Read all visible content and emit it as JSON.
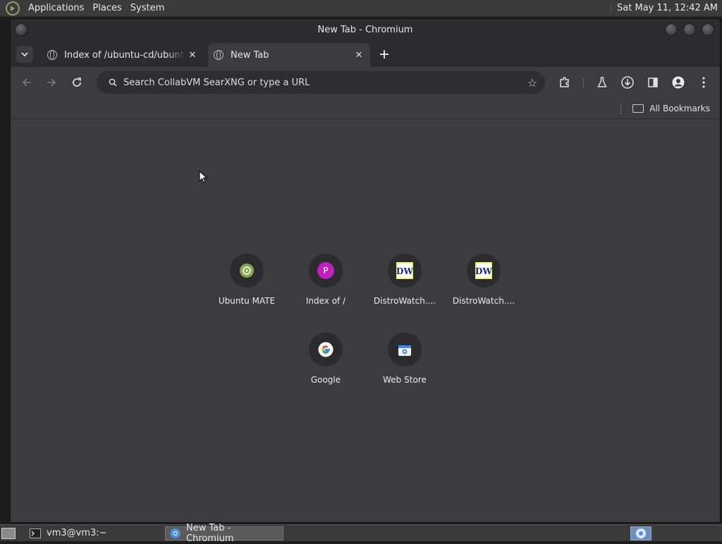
{
  "desktop": {
    "top_menu": [
      "Applications",
      "Places",
      "System"
    ],
    "clock": "Sat May 11, 12:42 AM"
  },
  "window": {
    "title": "New Tab - Chromium"
  },
  "tabs": [
    {
      "title": "Index of /ubuntu-cd/ubuntu-m",
      "close": "✕"
    },
    {
      "title": "New Tab",
      "close": "✕"
    }
  ],
  "toolbar": {
    "omnibox_placeholder": "Search CollabVM SearXNG or type a URL"
  },
  "bookmarks_bar": {
    "all_bookmarks": "All Bookmarks"
  },
  "shortcuts": [
    {
      "label": "Ubuntu MATE",
      "icon": "ubuntu-mate-icon"
    },
    {
      "label": "Index of /",
      "icon": "letter-p-icon",
      "letter": "P",
      "color": "#c020c0"
    },
    {
      "label": "DistroWatch....",
      "icon": "distrowatch-icon"
    },
    {
      "label": "DistroWatch....",
      "icon": "distrowatch-icon"
    },
    {
      "label": "Google",
      "icon": "google-icon"
    },
    {
      "label": "Web Store",
      "icon": "web-store-icon"
    }
  ],
  "taskbar": {
    "tasks": [
      "vm3@vm3:~",
      "New Tab - Chromium"
    ]
  }
}
